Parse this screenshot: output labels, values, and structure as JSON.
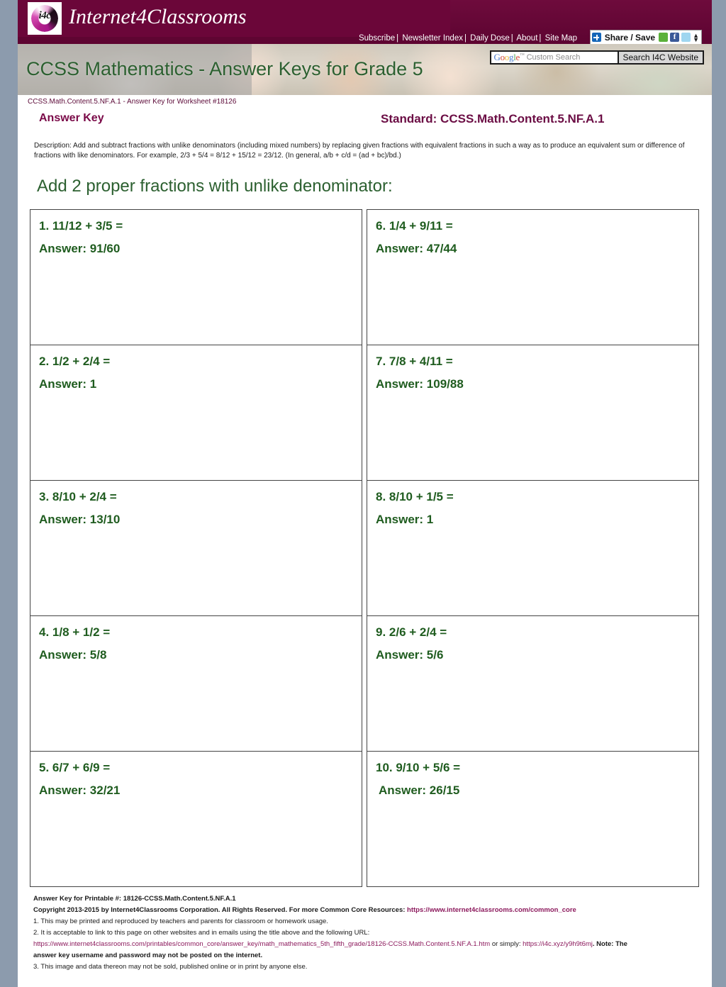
{
  "site": {
    "brand_name": "Internet4Classrooms",
    "logo_text": "i4c",
    "nav": [
      {
        "label": "Subscribe"
      },
      {
        "label": "Newsletter Index"
      },
      {
        "label": "Daily Dose"
      },
      {
        "label": "About"
      },
      {
        "label": "Site Map"
      }
    ],
    "share": {
      "label": "Share / Save",
      "icons": [
        "plus-icon",
        "sharethis-icon",
        "facebook-icon",
        "twitter-icon",
        "more-arrows-icon"
      ],
      "facebook_glyph": "f"
    },
    "search": {
      "placeholder": "Custom Search",
      "google_wordmark": "Google",
      "trademark": "™",
      "button_label": "Search I4C Website"
    }
  },
  "banner": {
    "title": "CCSS Mathematics - Answer Keys for Grade 5"
  },
  "worksheet": {
    "id_line": "CCSS.Math.Content.5.NF.A.1 - Answer Key for Worksheet #18126",
    "answer_key_label": "Answer Key",
    "standard_label": "Standard: CCSS.Math.Content.5.NF.A.1",
    "description": "Description: Add and subtract fractions with unlike denominators (including mixed numbers) by replacing given fractions with equivalent fractions in such a way as to produce an equivalent sum or difference of fractions with like denominators. For example, 2/3 + 5/4 = 8/12 + 15/12 = 23/12. (In general, a/b + c/d = (ad + bc)/bd.)",
    "heading": "Add 2 proper fractions with unlike denominator:"
  },
  "questions": {
    "left": [
      {
        "question": "1. 11/12 + 3/5 =",
        "answer": "Answer: 91/60"
      },
      {
        "question": "2. 1/2 + 2/4 =",
        "answer": "Answer: 1"
      },
      {
        "question": "3. 8/10 + 2/4 =",
        "answer": "Answer: 13/10"
      },
      {
        "question": "4. 1/8 + 1/2 =",
        "answer": "Answer: 5/8"
      },
      {
        "question": "5. 6/7 + 6/9 =",
        "answer": "Answer: 32/21"
      }
    ],
    "right": [
      {
        "question": "6. 1/4 + 9/11 =",
        "answer": "Answer: 47/44"
      },
      {
        "question": "7. 7/8 + 4/11 =",
        "answer": "Answer: 109/88"
      },
      {
        "question": "8. 8/10 + 1/5 =",
        "answer": "Answer: 1"
      },
      {
        "question": "9. 2/6 + 2/4 =",
        "answer": "Answer: 5/6"
      },
      {
        "question": "10. 9/10 + 5/6 =",
        "answer": "Answer: 26/15"
      }
    ]
  },
  "footer": {
    "printable_line": "Answer Key for Printable #: 18126-CCSS.Math.Content.5.NF.A.1",
    "copyright_prefix": "Copyright 2013-2015 by Internet4Classrooms Corporation. All Rights Reserved. For more Common Core Resources: ",
    "copyright_link": "https://www.internet4classrooms.com/common_core",
    "note1": "1. This may be printed and reproduced by teachers and parents for classroom or homework usage.",
    "note2": "2. It is acceptable to link to this page on other websites and in emails using the title above and the following URL:",
    "long_url": "https://www.internet4classrooms.com/printables/common_core/answer_key/math_mathematics_5th_fifth_grade/18126-CCSS.Math.Content.5.NF.A.1.htm",
    "or_simply": " or simply: ",
    "short_url": "https://i4c.xyz/y9h9t6mj",
    "note_suffix": ". Note: The",
    "note2_cont": "answer key username and password may not be posted on the internet.",
    "note3": "3. This image and data thereon may not be sold, published online or in print by anyone else."
  },
  "colors": {
    "brand_maroon": "#6b0639",
    "heading_green": "#2c6030",
    "answer_green": "#1f5c1f",
    "standard_purple": "#6b0d44",
    "link_purple": "#8c1a5d",
    "page_surround": "#8c9bad"
  }
}
